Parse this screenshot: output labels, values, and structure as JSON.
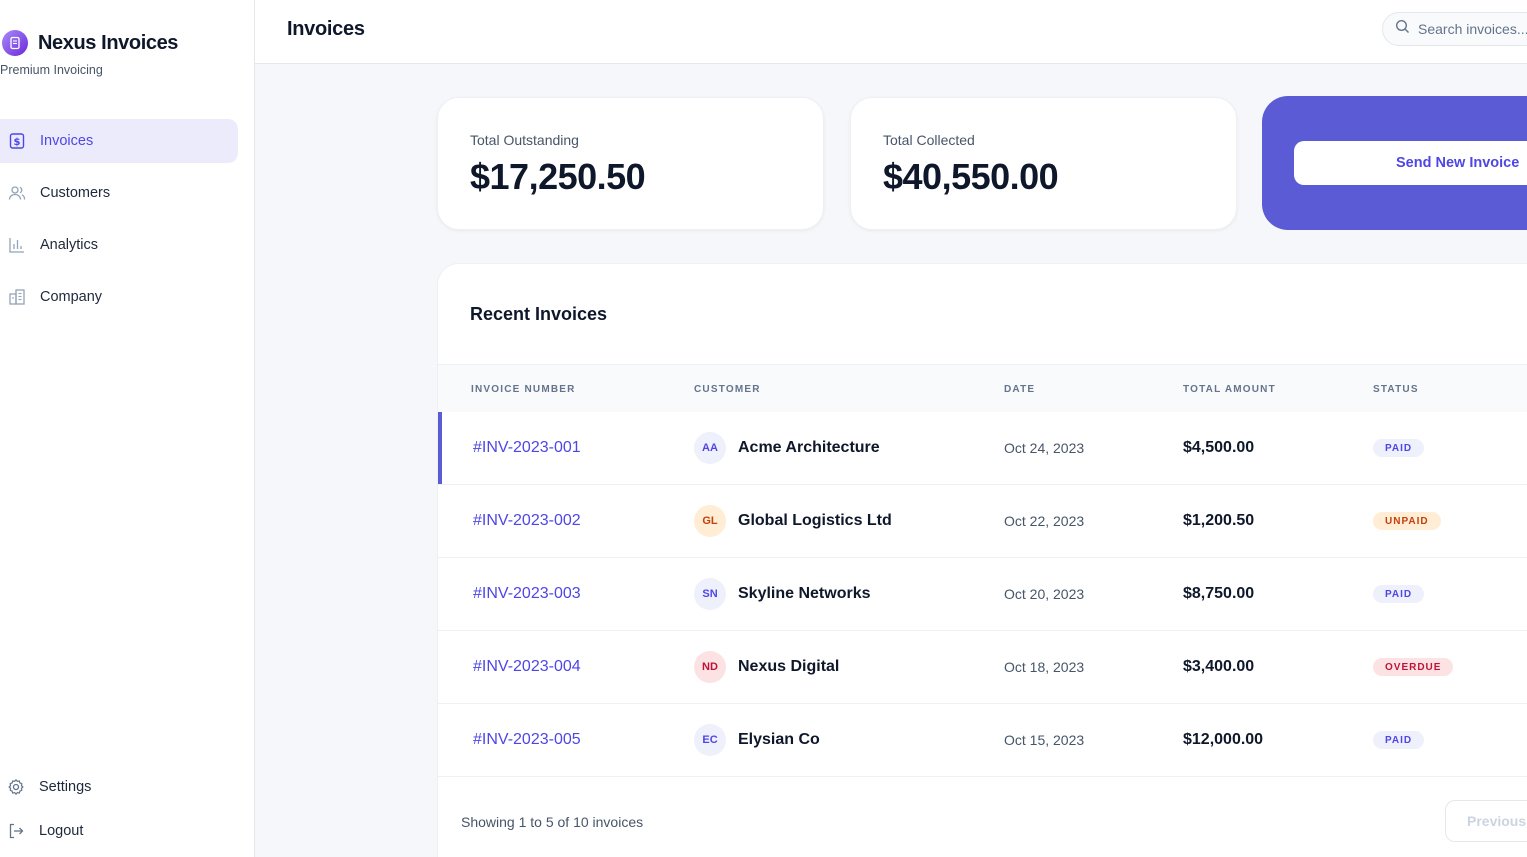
{
  "app": {
    "name": "Nexus Invoices",
    "tagline": "Premium Invoicing",
    "logo_icon": "document-icon",
    "accent_color": "#5b5bd6"
  },
  "sidebar": {
    "items": [
      {
        "label": "Invoices",
        "icon": "invoice-icon",
        "active": true
      },
      {
        "label": "Customers",
        "icon": "users-icon",
        "active": false
      },
      {
        "label": "Analytics",
        "icon": "bar-chart-icon",
        "active": false
      },
      {
        "label": "Company",
        "icon": "building-icon",
        "active": false
      }
    ],
    "bottom_items": [
      {
        "label": "Settings",
        "icon": "gear-icon"
      },
      {
        "label": "Logout",
        "icon": "logout-icon"
      }
    ]
  },
  "header": {
    "title": "Invoices",
    "search_placeholder": "Search invoices..."
  },
  "stats": {
    "outstanding_label": "Total Outstanding",
    "outstanding_value": "$17,250.50",
    "collected_label": "Total Collected",
    "collected_value": "$40,550.00",
    "cta_label": "Send New Invoice"
  },
  "table": {
    "title": "Recent Invoices",
    "columns": [
      "Invoice Number",
      "Customer",
      "Date",
      "Total Amount",
      "Status"
    ],
    "rows": [
      {
        "number": "#INV-2023-001",
        "initials": "AA",
        "customer": "Acme Architecture",
        "date": "Oct 24, 2023",
        "amount": "$4,500.00",
        "status": "PAID",
        "selected": true
      },
      {
        "number": "#INV-2023-002",
        "initials": "GL",
        "customer": "Global Logistics Ltd",
        "date": "Oct 22, 2023",
        "amount": "$1,200.50",
        "status": "UNPAID",
        "selected": false
      },
      {
        "number": "#INV-2023-003",
        "initials": "SN",
        "customer": "Skyline Networks",
        "date": "Oct 20, 2023",
        "amount": "$8,750.00",
        "status": "PAID",
        "selected": false
      },
      {
        "number": "#INV-2023-004",
        "initials": "ND",
        "customer": "Nexus Digital",
        "date": "Oct 18, 2023",
        "amount": "$3,400.00",
        "status": "OVERDUE",
        "selected": false
      },
      {
        "number": "#INV-2023-005",
        "initials": "EC",
        "customer": "Elysian Co",
        "date": "Oct 15, 2023",
        "amount": "$12,000.00",
        "status": "PAID",
        "selected": false
      }
    ],
    "status_colors": {
      "PAID": {
        "bg": "#eef0fb",
        "fg": "#4f46e5"
      },
      "UNPAID": {
        "bg": "#ffedd5",
        "fg": "#c2410c"
      },
      "OVERDUE": {
        "bg": "#fde2e4",
        "fg": "#be123c"
      }
    },
    "avatar_colors": {
      "AA": {
        "bg": "#eef0fb",
        "fg": "#4f46e5"
      },
      "GL": {
        "bg": "#ffedd5",
        "fg": "#c2410c"
      },
      "SN": {
        "bg": "#eef0fb",
        "fg": "#4f46e5"
      },
      "ND": {
        "bg": "#fde2e4",
        "fg": "#be123c"
      },
      "EC": {
        "bg": "#eef0fb",
        "fg": "#4f46e5"
      }
    },
    "footer_text": "Showing 1 to 5 of 10 invoices",
    "prev_label": "Previous"
  }
}
